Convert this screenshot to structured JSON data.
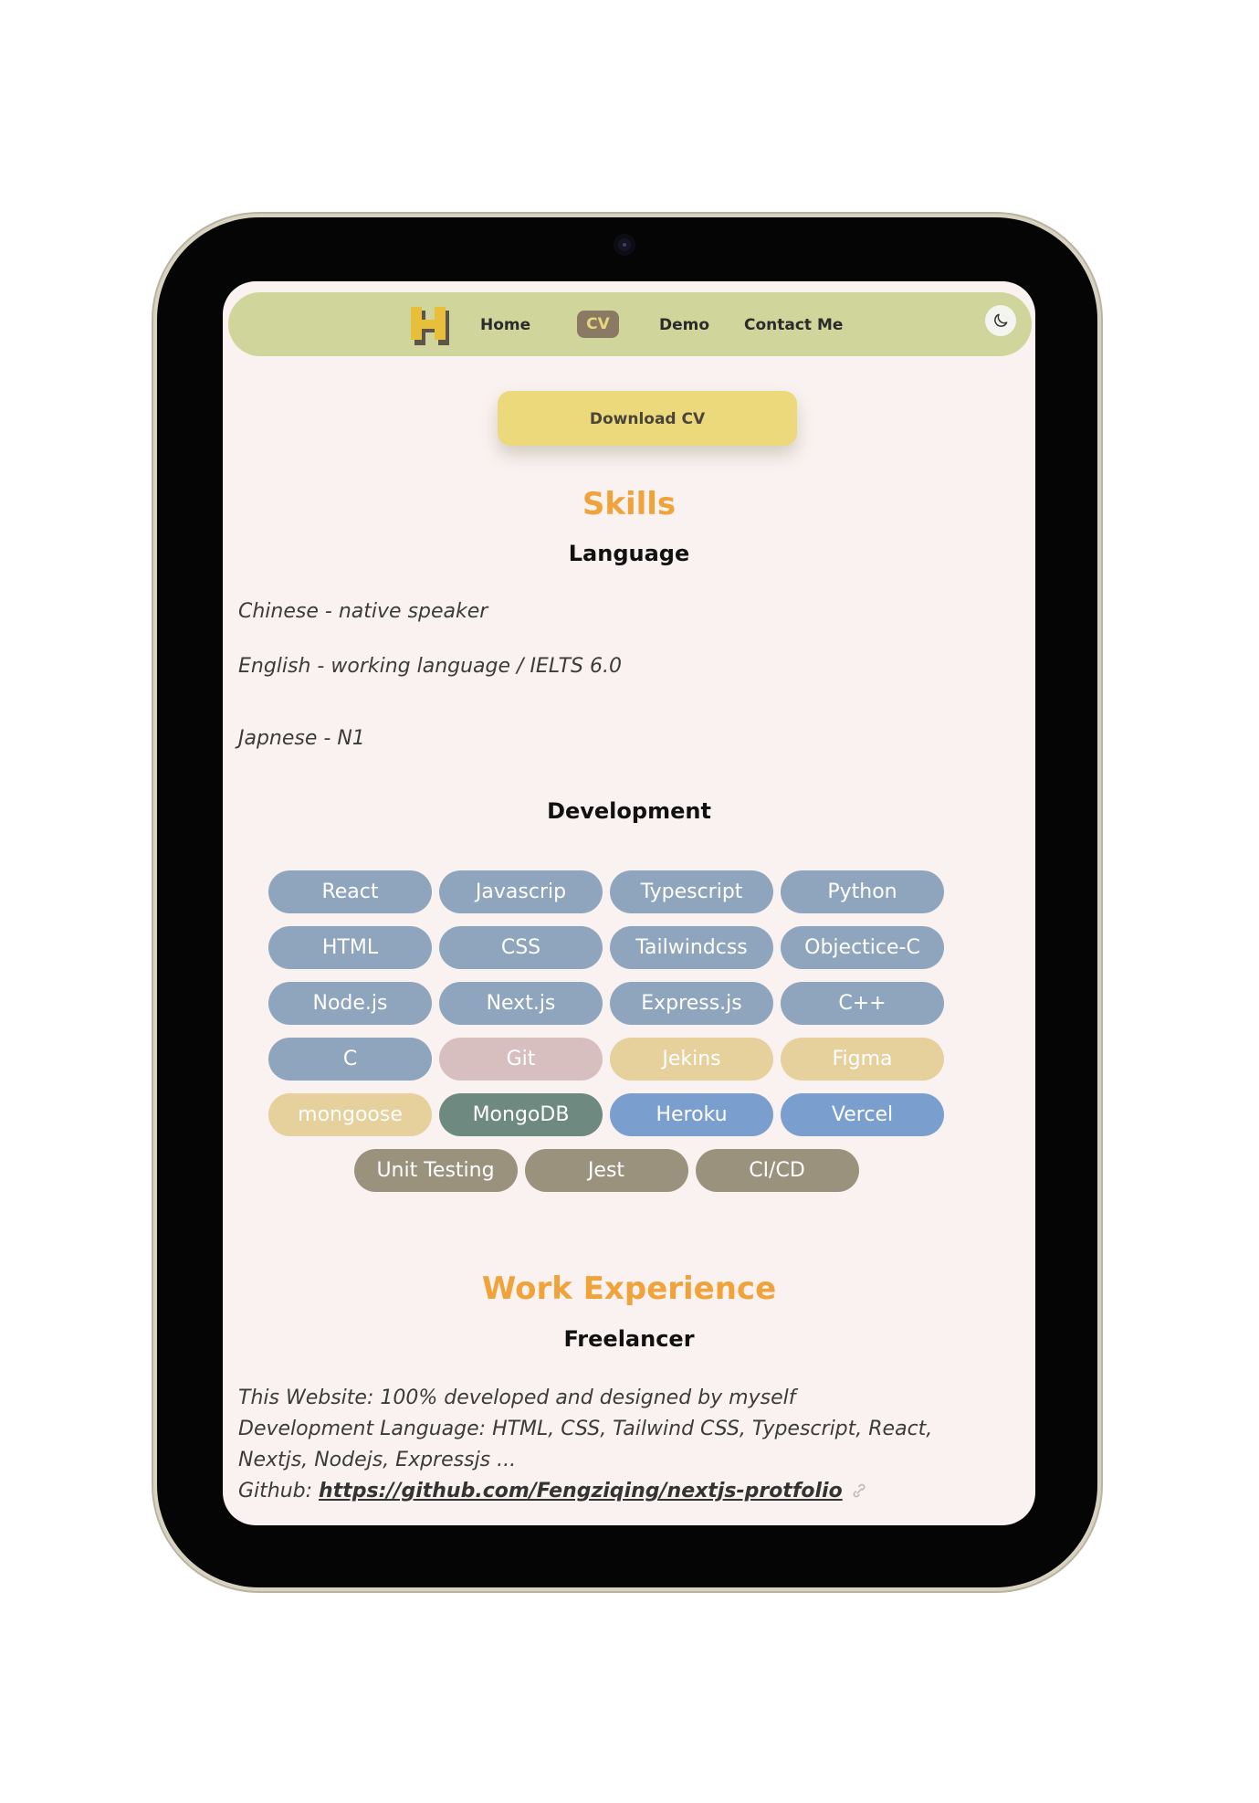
{
  "nav": {
    "items": [
      "Home",
      "CV",
      "Demo",
      "Contact Me"
    ],
    "active": "CV",
    "theme_toggle_icon": "moon-icon"
  },
  "download_label": "Download CV",
  "skills": {
    "title": "Skills",
    "language": {
      "title": "Language",
      "items": [
        "Chinese - native speaker",
        "English - working language / IELTS 6.0",
        "Japnese - N1"
      ]
    },
    "development": {
      "title": "Development",
      "pills": [
        {
          "label": "React",
          "color": "#8ea5bd"
        },
        {
          "label": "Javascrip",
          "color": "#8ea5bd"
        },
        {
          "label": "Typescript",
          "color": "#8ea5bd"
        },
        {
          "label": "Python",
          "color": "#8ea5bd"
        },
        {
          "label": "HTML",
          "color": "#8ea5bd"
        },
        {
          "label": "CSS",
          "color": "#8ea5bd"
        },
        {
          "label": "Tailwindcss",
          "color": "#8ea5bd"
        },
        {
          "label": "Objectice-C",
          "color": "#8ea5bd"
        },
        {
          "label": "Node.js",
          "color": "#8ea5bd"
        },
        {
          "label": "Next.js",
          "color": "#8ea5bd"
        },
        {
          "label": "Express.js",
          "color": "#8ea5bd"
        },
        {
          "label": "C++",
          "color": "#8ea5bd"
        },
        {
          "label": "C",
          "color": "#8ea5bd"
        },
        {
          "label": "Git",
          "color": "#d7bfc0"
        },
        {
          "label": "Jekins",
          "color": "#e6d09b"
        },
        {
          "label": "Figma",
          "color": "#e6d09b"
        },
        {
          "label": "mongoose",
          "color": "#e6d09b"
        },
        {
          "label": "MongoDB",
          "color": "#6e8a80"
        },
        {
          "label": "Heroku",
          "color": "#7a9fcf"
        },
        {
          "label": "Vercel",
          "color": "#7a9fcf"
        },
        {
          "label": "Unit Testing",
          "color": "#9a927d"
        },
        {
          "label": "Jest",
          "color": "#9a927d"
        },
        {
          "label": "CI/CD",
          "color": "#9a927d"
        }
      ]
    }
  },
  "work": {
    "title": "Work Experience",
    "role": "Freelancer",
    "line1": "This Website: 100% developed and designed by myself",
    "line2": "Development Language: HTML, CSS, Tailwind CSS, Typescript, React, Nextjs, Nodejs, Expressjs ...",
    "github_prefix": "Github: ",
    "github_link": "https://github.com/Fengziqing/nextjs-protfolio",
    "link_icon": "link-icon"
  },
  "colors": {
    "navbar": "#cfd59b",
    "accent_orange": "#f0a23b",
    "download_button": "#ecd97c",
    "screen_bg": "#faf2f0"
  }
}
